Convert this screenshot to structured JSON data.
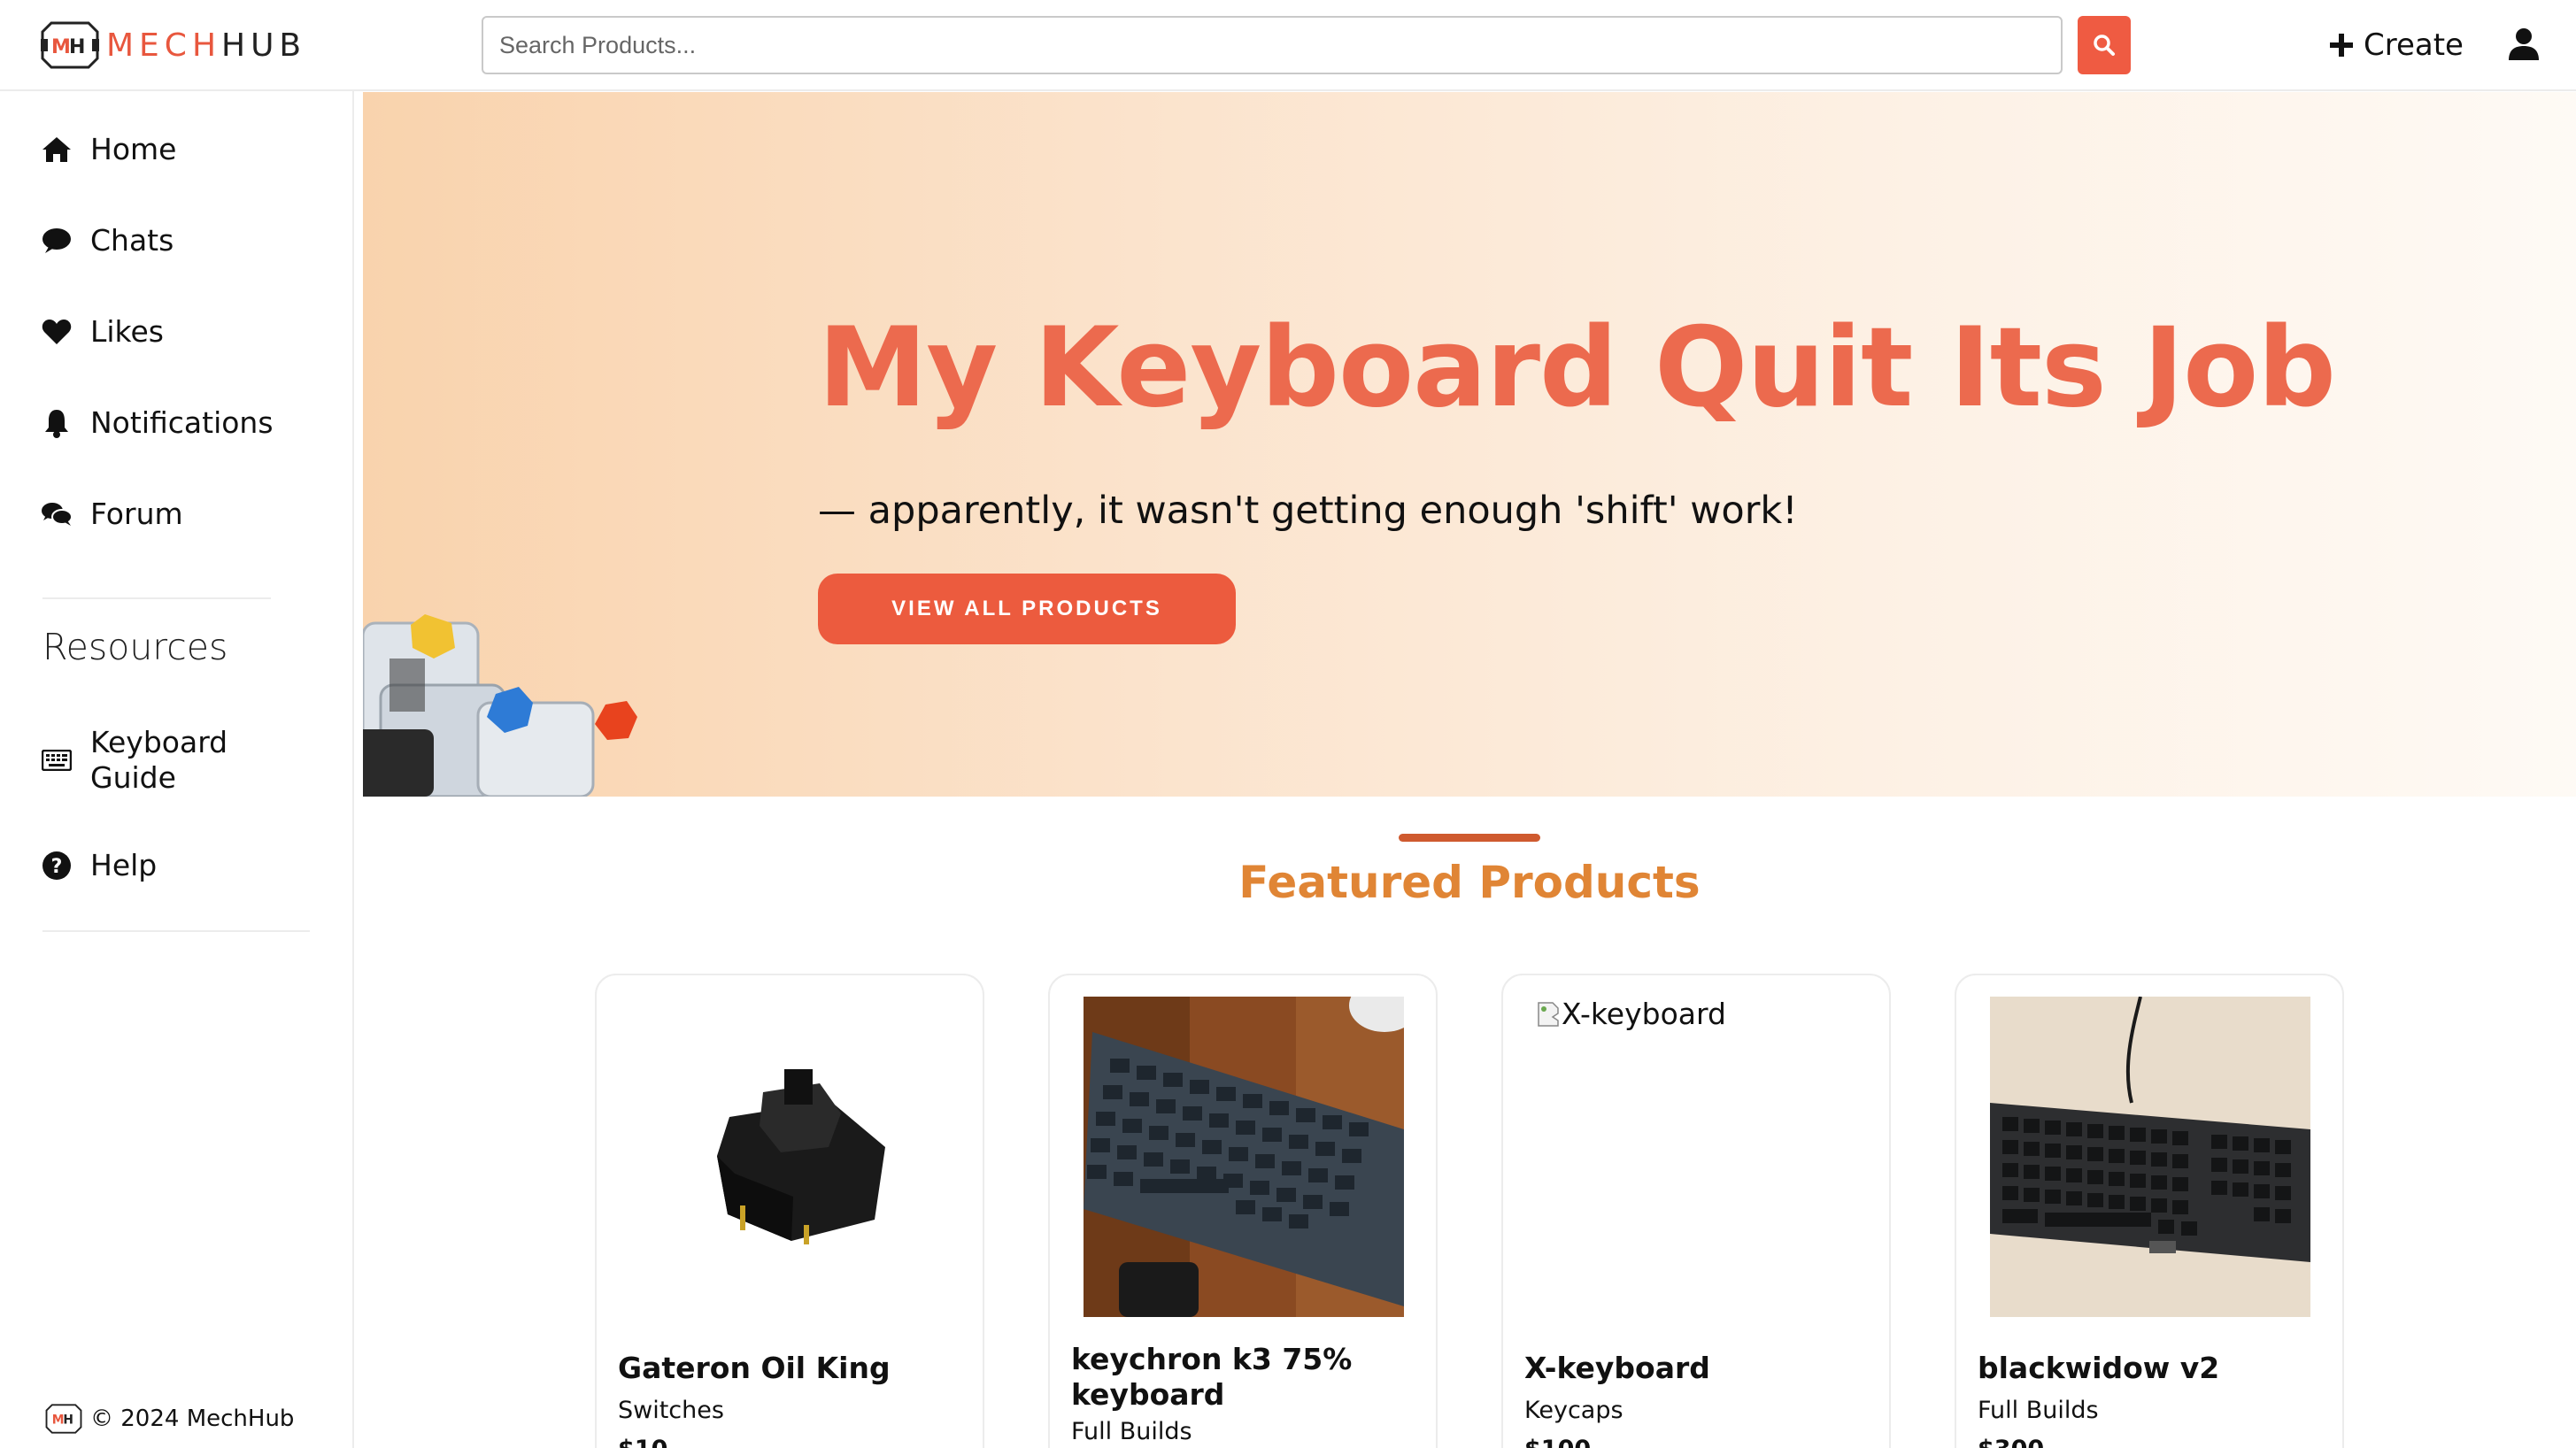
{
  "header": {
    "logo_text_left": "MECH",
    "logo_text_right": "HUB",
    "search_placeholder": "Search Products...",
    "create_label": "Create",
    "accent_color": "#ef5b42"
  },
  "sidebar": {
    "items": [
      {
        "label": "Home",
        "icon": "home-icon"
      },
      {
        "label": "Chats",
        "icon": "chat-icon"
      },
      {
        "label": "Likes",
        "icon": "heart-icon"
      },
      {
        "label": "Notifications",
        "icon": "bell-icon"
      },
      {
        "label": "Forum",
        "icon": "forum-icon"
      }
    ],
    "resources_title": "Resources",
    "resources": [
      {
        "label": "Keyboard Guide",
        "icon": "keyboard-icon"
      },
      {
        "label": "Help",
        "icon": "help-icon"
      }
    ],
    "footer": "© 2024 MechHub"
  },
  "hero": {
    "title": "My Keyboard Quit Its Job",
    "subtitle": "— apparently, it wasn't getting enough 'shift' work!",
    "cta_label": "VIEW ALL PRODUCTS",
    "title_color": "#ec6a4e"
  },
  "featured": {
    "title": "Featured Products",
    "products": [
      {
        "name": "Gateron Oil King",
        "category": "Switches",
        "price": "$10"
      },
      {
        "name": "keychron k3 75% keyboard",
        "category": "Full Builds",
        "price": ""
      },
      {
        "name": "X-keyboard",
        "category": "Keycaps",
        "price": "$100",
        "image_alt": "X-keyboard"
      },
      {
        "name": "blackwidow v2",
        "category": "Full Builds",
        "price": "$300"
      }
    ]
  }
}
